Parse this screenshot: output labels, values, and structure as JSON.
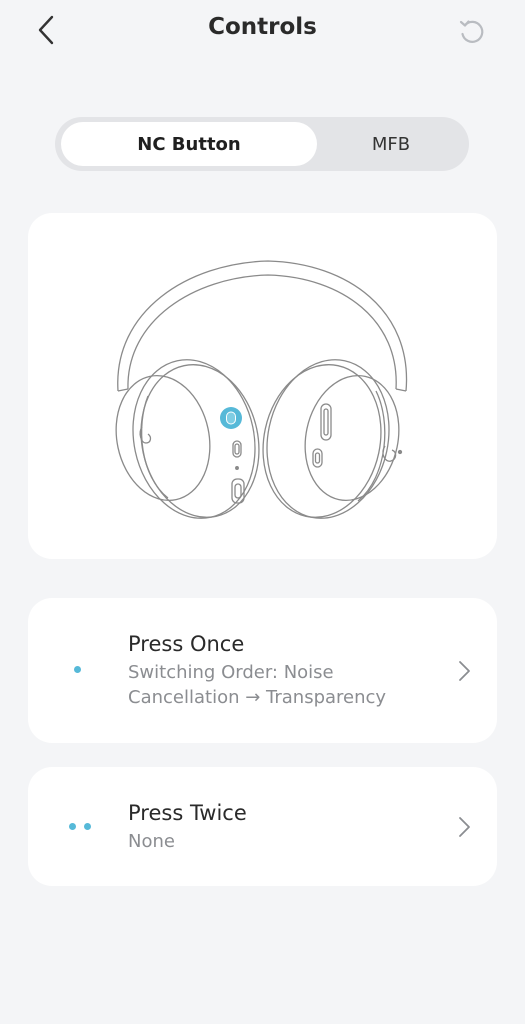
{
  "header": {
    "title": "Controls"
  },
  "tabs": [
    {
      "label": "NC Button",
      "active": true
    },
    {
      "label": "MFB",
      "active": false
    }
  ],
  "illustration": {
    "highlight_color": "#56b9d8"
  },
  "actions": [
    {
      "title": "Press Once",
      "subtitle": "Switching Order: Noise Cancellation → Transparency",
      "dots": 1
    },
    {
      "title": "Press Twice",
      "subtitle": "None",
      "dots": 2
    }
  ],
  "colors": {
    "accent": "#56b9d8",
    "background": "#f4f5f7",
    "card": "#ffffff"
  }
}
